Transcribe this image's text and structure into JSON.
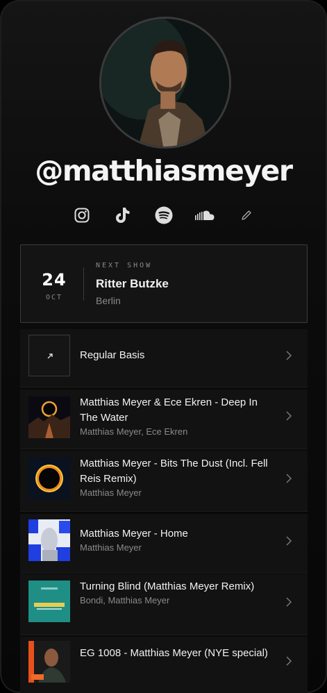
{
  "profile": {
    "handle": "@matthiasmeyer"
  },
  "socials": [
    "instagram-icon",
    "tiktok-icon",
    "spotify-icon",
    "soundcloud-icon",
    "pencil-icon"
  ],
  "next_show": {
    "label": "NEXT SHOW",
    "day": "24",
    "month": "OCT",
    "venue": "Ritter Butzke",
    "city": "Berlin"
  },
  "links": [
    {
      "title": "Regular Basis",
      "subtitle": "",
      "thumb": "arrow-icon"
    },
    {
      "title": "Matthias Meyer & Ece Ekren - Deep In The Water",
      "subtitle": "Matthias Meyer, Ece Ekren",
      "thumb": "cover-eclipse-landscape"
    },
    {
      "title": "Matthias Meyer - Bits The Dust (Incl. Fell Reis Remix)",
      "subtitle": "Matthias Meyer",
      "thumb": "cover-eclipse"
    },
    {
      "title": "Matthias Meyer - Home",
      "subtitle": "Matthias Meyer",
      "thumb": "cover-blue-figure"
    },
    {
      "title": "Turning Blind (Matthias Meyer Remix)",
      "subtitle": "Bondi, Matthias Meyer",
      "thumb": "cover-teal"
    },
    {
      "title": "EG 1008 - Matthias Meyer (NYE special)",
      "subtitle": "",
      "thumb": "cover-portrait-orange"
    }
  ],
  "colors": {
    "background": "#0c0c0c",
    "card": "#121212",
    "muted_text": "#8a8a8a"
  }
}
